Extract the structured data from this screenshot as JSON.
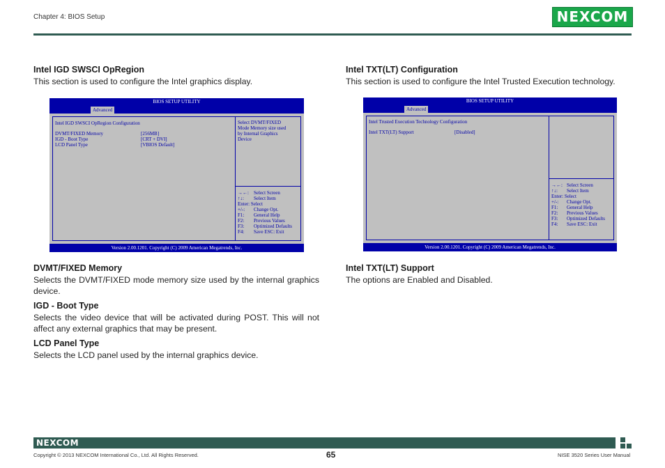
{
  "header": {
    "chapter": "Chapter 4: BIOS Setup",
    "logo": "NEXCOM",
    "brand_color": "#1aa74a",
    "rule_color": "#2f5b52"
  },
  "left": {
    "section1": {
      "heading": "Intel IGD SWSCI OpRegion",
      "text": "This section is used to configure the Intel graphics display."
    },
    "bios": {
      "title": "BIOS SETUP UTILITY",
      "tab": "Advanced",
      "config_title": "Intel IGD SWSCI OpRegion Configuration",
      "items": [
        {
          "label": "DVMT/FIXED Memory",
          "value": "[256MB]"
        },
        {
          "label": "IGD - Boot Type",
          "value": "[CRT + DVI]"
        },
        {
          "label": "LCD Panel Type",
          "value": "[VBIOS Default]"
        }
      ],
      "help": [
        "Select DVMT/FIXED",
        "Mode Memory size used",
        "by Internal Graphics",
        "Device"
      ],
      "keys": [
        {
          "k": "→←:",
          "d": "Select Screen"
        },
        {
          "k": "↑↓:",
          "d": "Select Item"
        },
        {
          "k": "Enter: Select",
          "d": ""
        },
        {
          "k": "+/-:",
          "d": "Change Opt."
        },
        {
          "k": "F1:",
          "d": "General Help"
        },
        {
          "k": "F2:",
          "d": "Previous Values"
        },
        {
          "k": "F3:",
          "d": "Optimized Defaults"
        },
        {
          "k": "F4:",
          "d": "Save   ESC: Exit"
        }
      ],
      "footer": "Version 2.00.1201. Copyright (C) 2009 American Megatrends, Inc."
    },
    "sections": [
      {
        "heading": "DVMT/FIXED Memory",
        "text": "Selects the DVMT/FIXED mode memory size used by the internal graphics device."
      },
      {
        "heading": "IGD - Boot Type",
        "text": "Selects the video device that will be activated during POST. This will not affect any external graphics that may be present."
      },
      {
        "heading": "LCD Panel Type",
        "text": "Selects the LCD panel used by the internal graphics device."
      }
    ]
  },
  "right": {
    "section1": {
      "heading": "Intel TXT(LT) Configuration",
      "text": "This section is used to configure the Intel Trusted Execution technology."
    },
    "bios": {
      "title": "BIOS SETUP UTILITY",
      "tab": "Advanced",
      "config_title": "Intel Trusted Execution Technology Configuration",
      "items": [
        {
          "label": "Intel TXT(LT) Support",
          "value": "[Disabled]"
        }
      ],
      "keys": [
        {
          "k": "→←:",
          "d": "Select Screen"
        },
        {
          "k": "↑↓:",
          "d": "Select Item"
        },
        {
          "k": "Enter: Select",
          "d": ""
        },
        {
          "k": "+/-:",
          "d": "Change Opt."
        },
        {
          "k": "F1:",
          "d": "General Help"
        },
        {
          "k": "F2:",
          "d": "Previous Values"
        },
        {
          "k": "F3:",
          "d": "Optimized Defaults"
        },
        {
          "k": "F4:",
          "d": "Save   ESC: Exit"
        }
      ],
      "footer": "Version 2.00.1201. Copyright (C) 2009 American Megatrends, Inc."
    },
    "section2": {
      "heading": "Intel TXT(LT) Support",
      "text": "The options are Enabled and Disabled."
    }
  },
  "footer": {
    "logo": "NEXCOM",
    "copyright": "Copyright © 2013 NEXCOM International Co., Ltd. All Rights Reserved.",
    "page": "65",
    "manual": "NISE 3520 Series User Manual"
  }
}
